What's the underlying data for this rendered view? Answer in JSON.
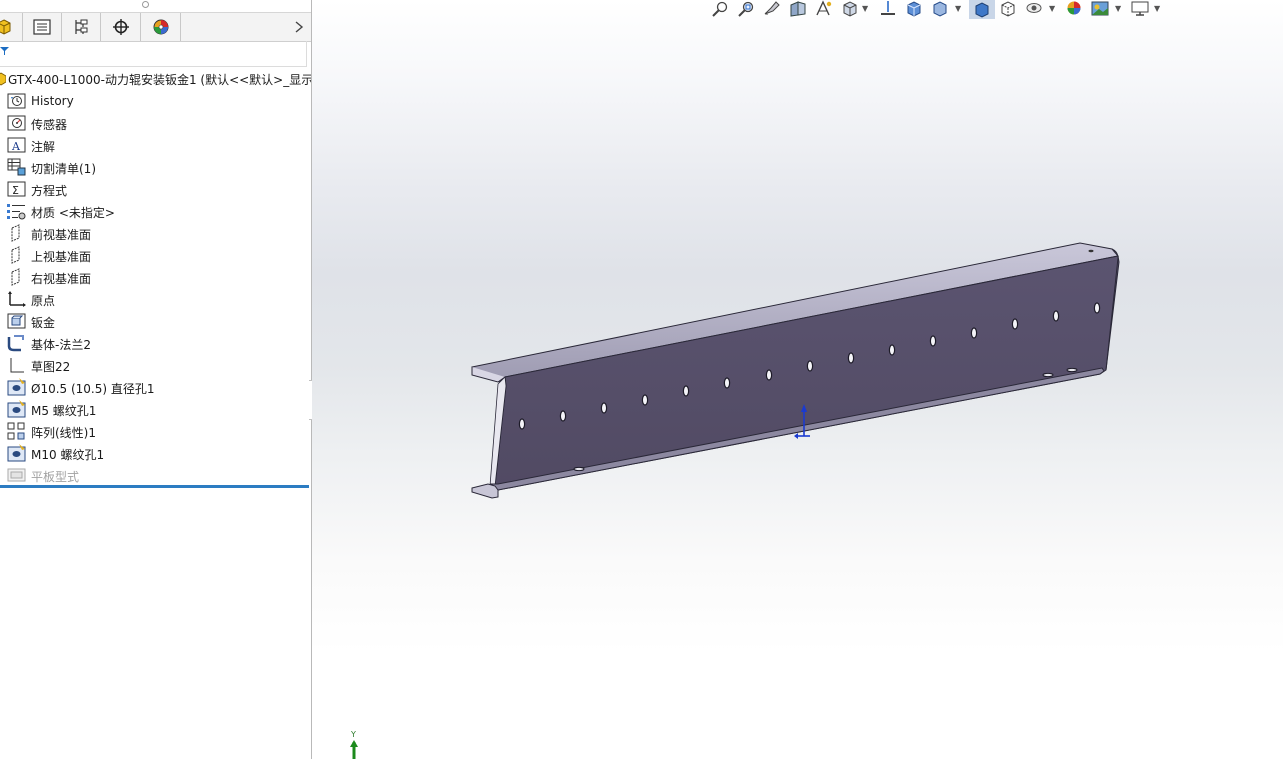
{
  "feature_manager": {
    "tabs": [
      {
        "name": "featuremanager-tab"
      },
      {
        "name": "propertymanager-tab"
      },
      {
        "name": "configurationmanager-tab"
      },
      {
        "name": "dimxpertmanager-tab"
      },
      {
        "name": "displaymanager-tab"
      }
    ],
    "root_label": "GTX-400-L1000-动力辊安装钣金1  (默认<<默认>_显示",
    "tree": [
      {
        "label": "History",
        "icon": "history-folder-icon"
      },
      {
        "label": "传感器",
        "icon": "sensors-icon"
      },
      {
        "label": "注解",
        "icon": "annotations-icon"
      },
      {
        "label": "切割清单(1)",
        "icon": "cut-list-icon"
      },
      {
        "label": "方程式",
        "icon": "equations-icon"
      },
      {
        "label": "材质 <未指定>",
        "icon": "material-icon"
      },
      {
        "label": "前视基准面",
        "icon": "plane-icon"
      },
      {
        "label": "上视基准面",
        "icon": "plane-icon"
      },
      {
        "label": "右视基准面",
        "icon": "plane-icon"
      },
      {
        "label": "原点",
        "icon": "origin-icon"
      },
      {
        "label": "钣金",
        "icon": "sheet-metal-icon"
      },
      {
        "label": "基体-法兰2",
        "icon": "base-flange-icon"
      },
      {
        "label": "草图22",
        "icon": "sketch-icon"
      },
      {
        "label": "Ø10.5 (10.5) 直径孔1",
        "icon": "hole-wizard-icon"
      },
      {
        "label": "M5 螺纹孔1",
        "icon": "hole-wizard-icon"
      },
      {
        "label": "阵列(线性)1",
        "icon": "linear-pattern-icon"
      },
      {
        "label": "M10 螺纹孔1",
        "icon": "hole-wizard-icon"
      },
      {
        "label": "平板型式",
        "icon": "flat-pattern-icon",
        "suppressed": true
      }
    ]
  },
  "viewport": {
    "triad_axis_label": "Y",
    "toolbar_icons": [
      "zoom-to-fit-icon",
      "zoom-to-area-icon",
      "previous-view-icon",
      "section-view-icon",
      "dynamic-annotation-icon",
      "view-orientation-icon",
      "display-style-icon",
      "hide-show-items-icon",
      "edit-appearance-icon",
      "apply-scene-icon",
      "view-settings-icon"
    ],
    "colors": {
      "part_face": "#58506a",
      "part_top_flange": "#b5b3c8",
      "part_edge": "#2a2838",
      "rollback_bar": "#2c7cc2"
    }
  }
}
